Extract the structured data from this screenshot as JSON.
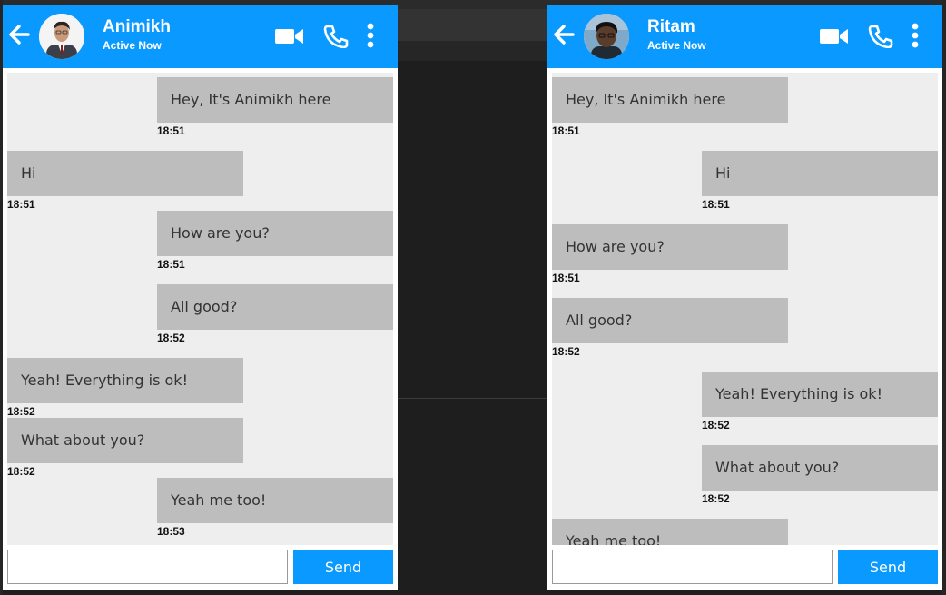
{
  "chats": [
    {
      "contact_name": "Animikh",
      "contact_status": "Active Now",
      "messages": [
        {
          "text": "Hey, It's Animikh here",
          "time": "18:51",
          "direction": "out"
        },
        {
          "text": "Hi",
          "time": "18:51",
          "direction": "in"
        },
        {
          "text": "How are you?",
          "time": "18:51",
          "direction": "out"
        },
        {
          "text": "All good?",
          "time": "18:52",
          "direction": "out"
        },
        {
          "text": "Yeah! Everything is ok!",
          "time": "18:52",
          "direction": "in"
        },
        {
          "text": "What about you?",
          "time": "18:52",
          "direction": "in"
        },
        {
          "text": "Yeah me too!",
          "time": "18:53",
          "direction": "out"
        }
      ],
      "input_value": "",
      "send_label": "Send"
    },
    {
      "contact_name": "Ritam",
      "contact_status": "Active Now",
      "messages": [
        {
          "text": "Hey, It's Animikh here",
          "time": "18:51",
          "direction": "in"
        },
        {
          "text": "Hi",
          "time": "18:51",
          "direction": "out"
        },
        {
          "text": "How are you?",
          "time": "18:51",
          "direction": "in"
        },
        {
          "text": "All good?",
          "time": "18:52",
          "direction": "in"
        },
        {
          "text": "Yeah! Everything is ok!",
          "time": "18:52",
          "direction": "out"
        },
        {
          "text": "What about you?",
          "time": "18:52",
          "direction": "out"
        },
        {
          "text": "Yeah me too!",
          "time": "",
          "direction": "in"
        }
      ],
      "input_value": "",
      "send_label": "Send"
    }
  ],
  "colors": {
    "header": "#0a9aff",
    "bubble": "#bdbdbd",
    "chat_bg": "#eeeeee",
    "send_button": "#0a9aff"
  },
  "icons": [
    "back-arrow-icon",
    "video-camera-icon",
    "phone-icon",
    "more-vertical-icon"
  ]
}
